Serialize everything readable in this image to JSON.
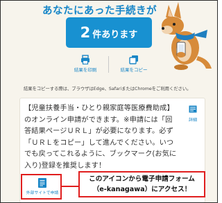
{
  "heading": "あなたにあった手続きが",
  "count": {
    "number": "2",
    "unit": "件あります"
  },
  "actions": {
    "print_label": "結果を印刷",
    "copy_label": "結果をコピー"
  },
  "note": "結果をコピーする際は、ブラウザはEdge、SafariまたはChromeをご利用ください。",
  "card": {
    "lines": [
      "【児童扶養手当・ひとり親家庭等医療費助成】",
      "のオンライン申請ができます。※申請には「回",
      "答結果ページＵＲＬ」が必要になります。必ず",
      "「ＵＲＬをコピー」して進んでください。いつ",
      "でも戻ってこれるように、ブックマーク(お気に",
      "入り)登録を推奨します！"
    ],
    "detail_label": "詳細",
    "external_label": "外部サイトで申請"
  },
  "callout": {
    "line1": "このアイコンから電子申請フォーム",
    "line2": "（e-kanagawa）にアクセス！"
  },
  "colors": {
    "accent": "#1891d1",
    "highlight": "#e01e1e",
    "background": "#f7f4ec"
  },
  "icons": [
    "mascot-icon",
    "printer-icon",
    "copy-icon",
    "detail-icon",
    "external-site-icon"
  ]
}
